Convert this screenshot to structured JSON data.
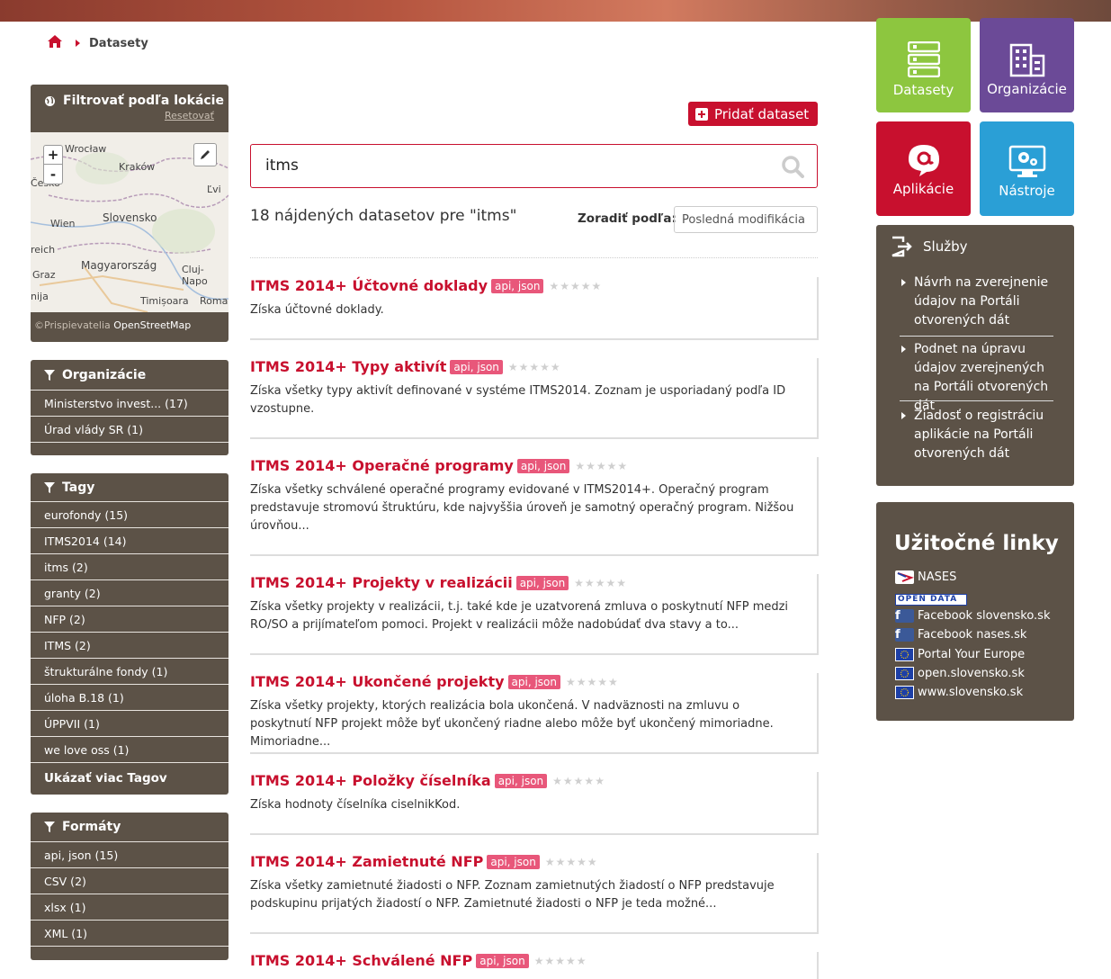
{
  "breadcrumb": {
    "current": "Datasety"
  },
  "location_filter": {
    "title": "Filtrovať podľa lokácie",
    "reset": "Resetovať",
    "zoom_in": "+",
    "zoom_out": "-",
    "attribution_prefix": "©Prispievatelia",
    "attribution_link": "OpenStreetMap",
    "map_labels": [
      "Wrocław",
      "Kraków",
      "Česko",
      "Ľvi",
      "Slovensko",
      "Wien",
      "reich",
      "Graz",
      "Magyarország",
      "Cluj-Napo",
      "nija",
      "Timișoara",
      "Roma"
    ]
  },
  "organizations": {
    "title": "Organizácie",
    "items": [
      "Ministerstvo invest... (17)",
      "Úrad vlády SR (1)"
    ]
  },
  "tags": {
    "title": "Tagy",
    "items": [
      "eurofondy (15)",
      "ITMS2014 (14)",
      "itms (2)",
      "granty (2)",
      "NFP (2)",
      "ITMS (2)",
      "štrukturálne fondy (1)",
      "úloha B.18 (1)",
      "ÚPPVII (1)",
      "we love oss (1)"
    ],
    "more": "Ukázať viac Tagov"
  },
  "formats": {
    "title": "Formáty",
    "items": [
      "api, json (15)",
      "CSV (2)",
      "xlsx (1)",
      "XML (1)"
    ]
  },
  "add_dataset": "Pridať dataset",
  "search": {
    "value": "itms"
  },
  "results": {
    "count_text": "18 nájdených datasetov pre \"itms\"",
    "sort_label": "Zoradiť podľa:",
    "sort_value": "Posledná modifikácia"
  },
  "datasets": [
    {
      "title": "ITMS 2014+ Účtovné doklady",
      "format": "api, json",
      "rating": "★★★★★",
      "description": "Získa účtovné doklady."
    },
    {
      "title": "ITMS 2014+ Typy aktivít",
      "format": "api, json",
      "rating": "★★★★★",
      "description": "Získa všetky typy aktivít definované v systéme ITMS2014. Zoznam je usporiadaný podľa ID vzostupne."
    },
    {
      "title": "ITMS 2014+ Operačné programy",
      "format": "api, json",
      "rating": "★★★★★",
      "description": "Získa všetky schválené operačné programy evidované v ITMS2014+. Operačný program predstavuje stromovú štruktúru, kde najvyššia úroveň je samotný operačný program. Nižšou úrovňou..."
    },
    {
      "title": "ITMS 2014+ Projekty v realizácii",
      "format": "api, json",
      "rating": "★★★★★",
      "description": "Získa všetky projekty v realizácii, t.j. také kde je uzatvorená zmluva o poskytnutí NFP medzi RO/SO a prijímateľom pomoci. Projekt v realizácii môže nadobúdať dva stavy a to..."
    },
    {
      "title": "ITMS 2014+ Ukončené projekty",
      "format": "api, json",
      "rating": "★★★★★",
      "description": "Získa všetky projekty, ktorých realizácia bola ukončená. V nadväznosti na zmluvu o poskytnutí NFP projekt môže byť ukončený riadne alebo môže byť ukončený mimoriadne. Mimoriadne..."
    },
    {
      "title": "ITMS 2014+ Položky číselníka",
      "format": "api, json",
      "rating": "★★★★★",
      "description": "Získa hodnoty číselníka ciselnikKod."
    },
    {
      "title": "ITMS 2014+ Zamietnuté NFP",
      "format": "api, json",
      "rating": "★★★★★",
      "description": "Získa všetky zamietnuté žiadosti o NFP. Zoznam zamietnutých žiadostí o NFP predstavuje podskupinu prijatých žiadostí o NFP. Zamietnuté žiadosti o NFP je teda možné..."
    },
    {
      "title": "ITMS 2014+ Schválené NFP",
      "format": "api, json",
      "rating": "★★★★★",
      "description": ""
    }
  ],
  "tiles": [
    {
      "label": "Datasety",
      "color": "#8dc63f"
    },
    {
      "label": "Organizácie",
      "color": "#6b4a97"
    },
    {
      "label": "Aplikácie",
      "color": "#c8102e"
    },
    {
      "label": "Nástroje",
      "color": "#2a9fd6"
    }
  ],
  "services": {
    "title": "Služby",
    "items": [
      "Návrh na zverejnenie údajov na Portáli otvorených dát",
      "Podnet na úpravu údajov zverejnených na Portáli otvorených dát",
      "Žiadosť o registráciu aplikácie na Portáli otvorených dát"
    ]
  },
  "useful_links": {
    "title": "Užitočné linky",
    "items": [
      {
        "label": "NASES",
        "icon": "nases-logo"
      },
      {
        "label": "OPEN DATA",
        "icon": "open-data-logo"
      },
      {
        "label": "Facebook slovensko.sk",
        "icon": "facebook-icon"
      },
      {
        "label": "Facebook nases.sk",
        "icon": "facebook-icon"
      },
      {
        "label": "Portal Your Europe",
        "icon": "eu-flag-icon"
      },
      {
        "label": "open.slovensko.sk",
        "icon": "eu-flag-icon"
      },
      {
        "label": "www.slovensko.sk",
        "icon": "eu-flag-icon"
      }
    ]
  },
  "colors": {
    "brand_red": "#c8102e",
    "panel_brown": "#5c5247",
    "tag_pink": "#e8577a"
  }
}
